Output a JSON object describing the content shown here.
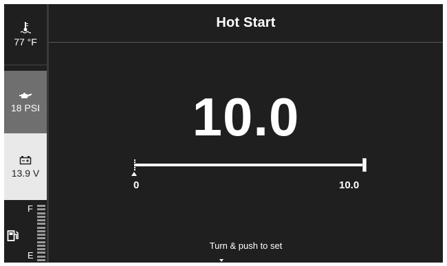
{
  "header": {
    "title": "Hot Start"
  },
  "sidebar": {
    "water_temp": {
      "icon": "water-temperature-icon",
      "value": "77 °F"
    },
    "oil_pressure": {
      "icon": "oil-can-icon",
      "value": "18 PSI"
    },
    "battery": {
      "icon": "battery-icon",
      "value": "13.9 V"
    },
    "fuel": {
      "icon": "fuel-pump-icon",
      "full_label": "F",
      "empty_label": "E"
    }
  },
  "main": {
    "value": "10.0",
    "slider": {
      "min_label": "0",
      "max_label": "10.0",
      "fraction": 1.0
    },
    "hint": "Turn & push to set"
  },
  "colors": {
    "background": "#1f1f1f",
    "text": "#ffffff",
    "oil_tile": "#6f6f6f",
    "battery_tile": "#e9e9e9"
  }
}
